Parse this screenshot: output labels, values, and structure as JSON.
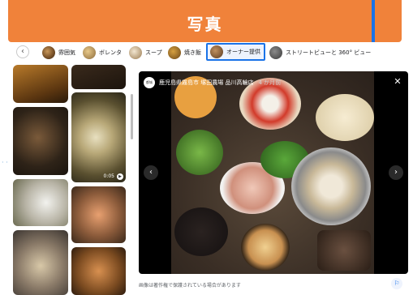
{
  "header": {
    "title": "写真"
  },
  "chips": [
    {
      "label": "雰囲気"
    },
    {
      "label": "ボレンタ"
    },
    {
      "label": "スープ"
    },
    {
      "label": "焼き飯"
    },
    {
      "label": "オーナー提供",
      "selected": true
    },
    {
      "label": "ストリートビューと 360° ビュー"
    }
  ],
  "viewer": {
    "place_avatar_text": "都城",
    "place_name": "鹿児島県霧島市 塚田農場 品川高輪店",
    "time_ago": "4 か月前",
    "close_symbol": "✕",
    "prev_symbol": "‹",
    "next_symbol": "›"
  },
  "thumbnail_video": {
    "duration": "0:05"
  },
  "footer": {
    "copyright_note": "画像は著作権で保護されている場合があります",
    "flag_symbol": "⚐"
  },
  "colors": {
    "header": "#f0823a",
    "selected_border": "#1a73e8"
  }
}
